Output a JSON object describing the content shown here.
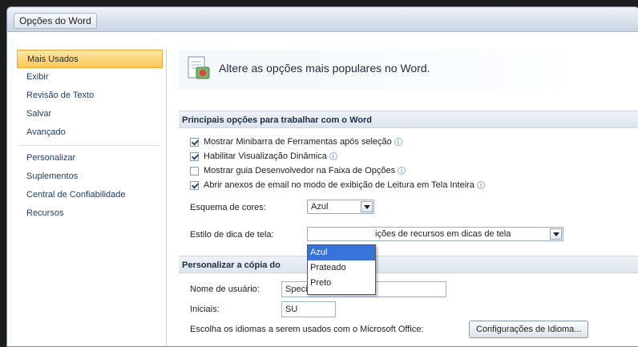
{
  "window": {
    "title": "Opções do Word"
  },
  "sidebar": {
    "items": [
      {
        "label": "Mais Usados",
        "selected": true
      },
      {
        "label": "Exibir"
      },
      {
        "label": "Revisão de Texto"
      },
      {
        "label": "Salvar"
      },
      {
        "label": "Avançado"
      },
      {
        "label": "Personalizar"
      },
      {
        "label": "Suplementos"
      },
      {
        "label": "Central de Confiabilidade"
      },
      {
        "label": "Recursos"
      }
    ]
  },
  "header": {
    "text": "Altere as opções mais populares no Word."
  },
  "sections": {
    "main": {
      "title": "Principais opções para trabalhar com o Word",
      "options": [
        {
          "label": "Mostrar Minibarra de Ferramentas após seleção",
          "checked": true
        },
        {
          "label": "Habilitar Visualização Dinâmica",
          "checked": true
        },
        {
          "label": "Mostrar guia Desenvolvedor na Faixa de Opções",
          "checked": false
        },
        {
          "label": "Abrir anexos de email no modo de exibição de Leitura em Tela Inteira",
          "checked": true
        }
      ],
      "color_scheme": {
        "label": "Esquema de cores:",
        "value": "Azul",
        "options": [
          "Azul",
          "Prateado",
          "Preto"
        ]
      },
      "tooltip_style": {
        "label": "Estilo de dica de tela:",
        "value": "Mostrar descrições de recursos em dicas de tela",
        "visible_text": "ições de recursos em dicas de tela"
      }
    },
    "personalize": {
      "title": "Personalizar a cópia do Microsoft Office",
      "visible_title_left": "Personalizar a cópia do ",
      "user_name": {
        "label": "Nome de usuário:",
        "value": "Special User"
      },
      "initials": {
        "label": "Iniciais:",
        "value": "SU"
      },
      "languages": {
        "label": "Escolha os idiomas a serem usados com o Microsoft Office:",
        "button": "Configurações de Idioma..."
      }
    }
  },
  "colors": {
    "selected_nav": "#f9c758",
    "dropdown_highlight": "#3874d8"
  }
}
